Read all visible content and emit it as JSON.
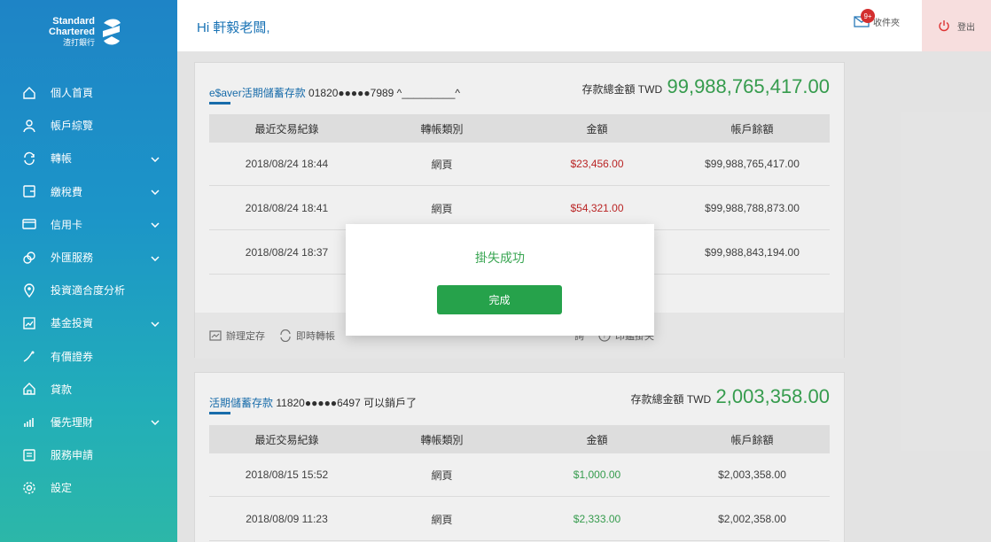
{
  "brand": {
    "line1": "Standard",
    "line2": "Chartered",
    "line3": "渣打銀行"
  },
  "header": {
    "greeting": "Hi 軒毅老闆,",
    "inbox_label": "收件夾",
    "inbox_badge": "9+",
    "logout_label": "登出"
  },
  "sidebar": {
    "items": [
      {
        "label": "個人首頁",
        "icon": "home-icon"
      },
      {
        "label": "帳戶綜覽",
        "icon": "person-icon"
      },
      {
        "label": "轉帳",
        "icon": "transfer-icon"
      },
      {
        "label": "繳稅費",
        "icon": "bill-icon"
      },
      {
        "label": "信用卡",
        "icon": "credit-card-icon"
      },
      {
        "label": "外匯服務",
        "icon": "forex-icon"
      },
      {
        "label": "投資適合度分析",
        "icon": "pin-icon"
      },
      {
        "label": "基金投資",
        "icon": "fund-icon"
      },
      {
        "label": "有價證券",
        "icon": "securities-icon"
      },
      {
        "label": "貸款",
        "icon": "loan-icon"
      },
      {
        "label": "優先理財",
        "icon": "priority-icon"
      },
      {
        "label": "服務申請",
        "icon": "application-icon"
      },
      {
        "label": "設定",
        "icon": "gear-icon"
      }
    ]
  },
  "accounts": [
    {
      "type": "e$aver活期儲蓄存款",
      "number": "01820●●●●●7989 ^_________^",
      "total_label": "存款總金額 TWD",
      "total_amount": "99,988,765,417.00",
      "columns": [
        "最近交易紀錄",
        "轉帳類別",
        "金額",
        "帳戶餘額"
      ],
      "rows": [
        {
          "date": "2018/08/24 18:44",
          "category": "網頁",
          "amount": "$23,456.00",
          "balance": "$99,988,765,417.00"
        },
        {
          "date": "2018/08/24 18:41",
          "category": "網頁",
          "amount": "$54,321.00",
          "balance": "$99,988,788,873.00"
        },
        {
          "date": "2018/08/24 18:37",
          "category": "網頁",
          "amount": "",
          "balance": "$99,988,843,194.00"
        }
      ],
      "actions": [
        {
          "label": "辦理定存",
          "icon": "deposit-icon"
        },
        {
          "label": "即時轉帳",
          "icon": "instant-transfer-icon"
        },
        {
          "label": "詢",
          "icon": "inquiry-icon"
        },
        {
          "label": "印鑑掛失",
          "icon": "seal-icon"
        }
      ]
    },
    {
      "type": "活期儲蓄存款",
      "number": "11820●●●●●6497 可以銷戶了",
      "total_label": "存款總金額 TWD",
      "total_amount": "2,003,358.00",
      "columns": [
        "最近交易紀錄",
        "轉帳類別",
        "金額",
        "帳戶餘額"
      ],
      "rows": [
        {
          "date": "2018/08/15 15:52",
          "category": "網頁",
          "amount": "$1,000.00",
          "balance": "$2,003,358.00"
        },
        {
          "date": "2018/08/09 11:23",
          "category": "網頁",
          "amount": "$2,333.00",
          "balance": "$2,002,358.00"
        }
      ]
    }
  ],
  "modal": {
    "message": "掛失成功",
    "button_label": "完成"
  },
  "colors": {
    "primary": "#1a73b5",
    "accent_green": "#3aa653",
    "button_green": "#26a24b",
    "debit_red": "#c62828"
  }
}
